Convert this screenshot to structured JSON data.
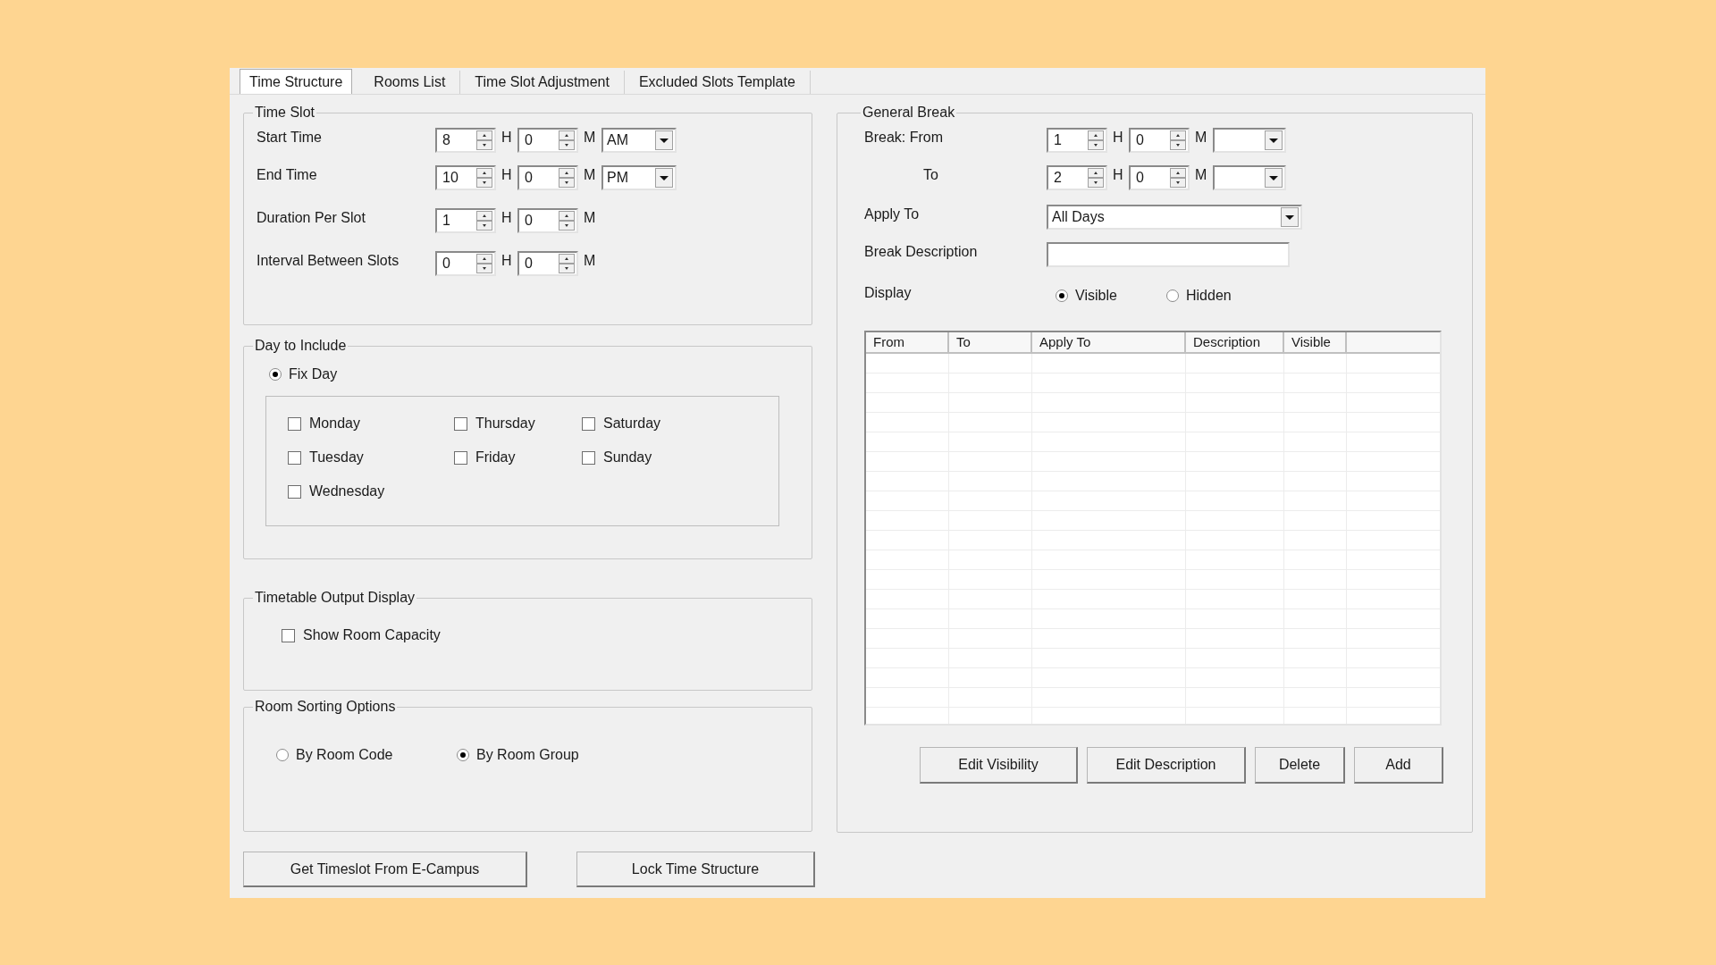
{
  "tabs": [
    {
      "label": "Time Structure",
      "selected": true
    },
    {
      "label": "Rooms List",
      "selected": false
    },
    {
      "label": "Time Slot Adjustment",
      "selected": false
    },
    {
      "label": "Excluded Slots Template",
      "selected": false
    }
  ],
  "time_slot": {
    "title": "Time Slot",
    "rows": [
      {
        "label": "Start Time",
        "hours": "8",
        "hour_unit": "H",
        "minutes": "0",
        "minute_unit": "M",
        "period": "AM"
      },
      {
        "label": "End Time",
        "hours": "10",
        "hour_unit": "H",
        "minutes": "0",
        "minute_unit": "M",
        "period": "PM"
      },
      {
        "label": "Duration Per Slot",
        "hours": "1",
        "hour_unit": "H",
        "minutes": "0",
        "minute_unit": "M"
      },
      {
        "label": "Interval Between Slots",
        "hours": "0",
        "hour_unit": "H",
        "minutes": "0",
        "minute_unit": "M"
      }
    ]
  },
  "day_to_include": {
    "title": "Day to Include",
    "mode": {
      "label": "Fix Day",
      "selected": true
    },
    "days": [
      {
        "label": "Monday",
        "checked": false
      },
      {
        "label": "Thursday",
        "checked": false
      },
      {
        "label": "Saturday",
        "checked": false
      },
      {
        "label": "Tuesday",
        "checked": false
      },
      {
        "label": "Friday",
        "checked": false
      },
      {
        "label": "Sunday",
        "checked": false
      },
      {
        "label": "Wednesday",
        "checked": false
      }
    ]
  },
  "output_display": {
    "title": "Timetable Output Display",
    "options": [
      {
        "label": "Show Room Capacity",
        "checked": false
      }
    ]
  },
  "room_sorting": {
    "title": "Room Sorting Options",
    "options": [
      {
        "label": "By Room Code",
        "selected": false
      },
      {
        "label": "By Room Group",
        "selected": true
      }
    ]
  },
  "left_buttons": [
    "Get Timeslot From E-Campus",
    "Lock Time Structure"
  ],
  "general_break": {
    "title": "General Break",
    "rows": [
      {
        "label": "Break: From",
        "hours": "1",
        "hour_unit": "H",
        "minutes": "0",
        "minute_unit": "M"
      },
      {
        "label": "To",
        "hours": "2",
        "hour_unit": "H",
        "minutes": "0",
        "minute_unit": "M"
      }
    ],
    "apply_to": {
      "label": "Apply To",
      "value": "All Days"
    },
    "description": {
      "label": "Break Description"
    },
    "display": {
      "label": "Display",
      "options": [
        {
          "label": "Visible",
          "selected": true
        },
        {
          "label": "Hidden",
          "selected": false
        }
      ]
    },
    "table": {
      "columns": [
        "From",
        "To",
        "Apply To",
        "Description",
        "Visible"
      ]
    },
    "buttons": [
      "Edit Visibility",
      "Edit Description",
      "Delete",
      "Add"
    ]
  }
}
